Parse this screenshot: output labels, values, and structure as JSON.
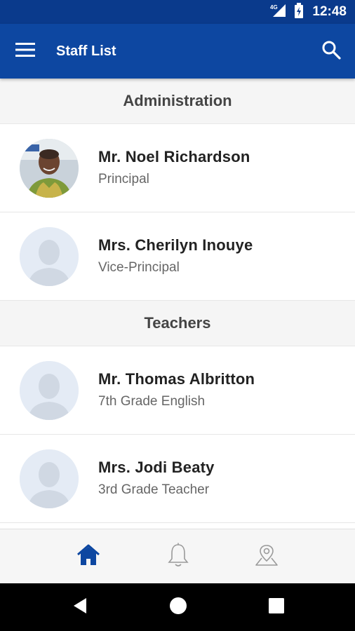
{
  "status_bar": {
    "time": "12:48",
    "network_label": "4G",
    "icons": [
      "signal-icon",
      "battery-charging-icon"
    ]
  },
  "app_bar": {
    "title": "Staff List",
    "menu_icon": "hamburger-menu-icon",
    "search_icon": "search-icon",
    "background_color": "#0d47a1"
  },
  "sections": [
    {
      "header": "Administration",
      "staff": [
        {
          "name": "Mr. Noel Richardson",
          "title": "Principal",
          "avatar": "photo"
        },
        {
          "name": "Mrs. Cherilyn Inouye",
          "title": "Vice-Principal",
          "avatar": "placeholder"
        }
      ]
    },
    {
      "header": "Teachers",
      "staff": [
        {
          "name": "Mr. Thomas Albritton",
          "title": "7th Grade English",
          "avatar": "placeholder"
        },
        {
          "name": "Mrs. Jodi Beaty",
          "title": "3rd Grade Teacher",
          "avatar": "placeholder"
        }
      ]
    }
  ],
  "bottom_nav": {
    "items": [
      {
        "icon": "home-icon",
        "active": true
      },
      {
        "icon": "bell-icon",
        "active": false
      },
      {
        "icon": "map-pin-icon",
        "active": false
      }
    ],
    "active_color": "#0d47a1",
    "inactive_color": "#9a9a9a"
  },
  "system_nav": {
    "items": [
      "back-icon",
      "home-circle-icon",
      "recents-icon"
    ]
  }
}
